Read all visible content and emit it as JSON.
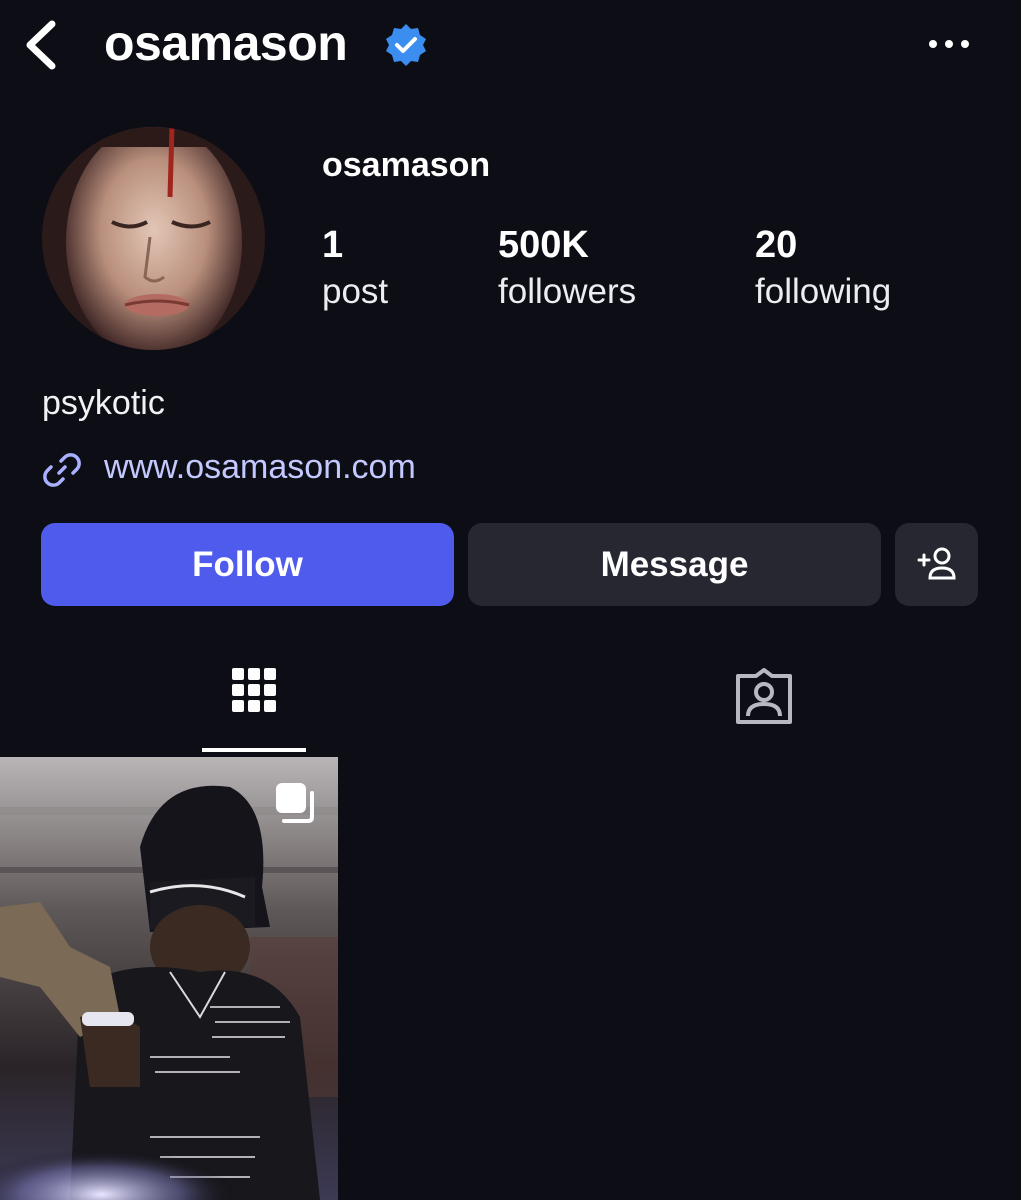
{
  "header": {
    "title": "osamason",
    "back_icon": "chevron-left-icon",
    "verified_icon": "verified-badge-icon",
    "more_icon": "more-horizontal-icon"
  },
  "profile": {
    "name": "osamason",
    "stats": [
      {
        "value": "1",
        "label": "post"
      },
      {
        "value": "500K",
        "label": "followers"
      },
      {
        "value": "20",
        "label": "following"
      }
    ],
    "bio": "psykotic",
    "link": "www.osamason.com",
    "link_icon": "link-icon"
  },
  "actions": {
    "follow_label": "Follow",
    "message_label": "Message",
    "add_icon": "add-person-icon"
  },
  "tabs": [
    {
      "name": "posts-grid",
      "icon": "grid-icon",
      "active": true
    },
    {
      "name": "tagged",
      "icon": "tagged-person-icon",
      "active": false
    }
  ],
  "posts": [
    {
      "type": "carousel",
      "icon": "multiple-images-icon"
    }
  ],
  "colors": {
    "background": "#0d0e15",
    "follow_button": "#4f5bed",
    "secondary_button": "#262731",
    "link": "#c3c8ff",
    "verified": "#3b8ef0"
  }
}
